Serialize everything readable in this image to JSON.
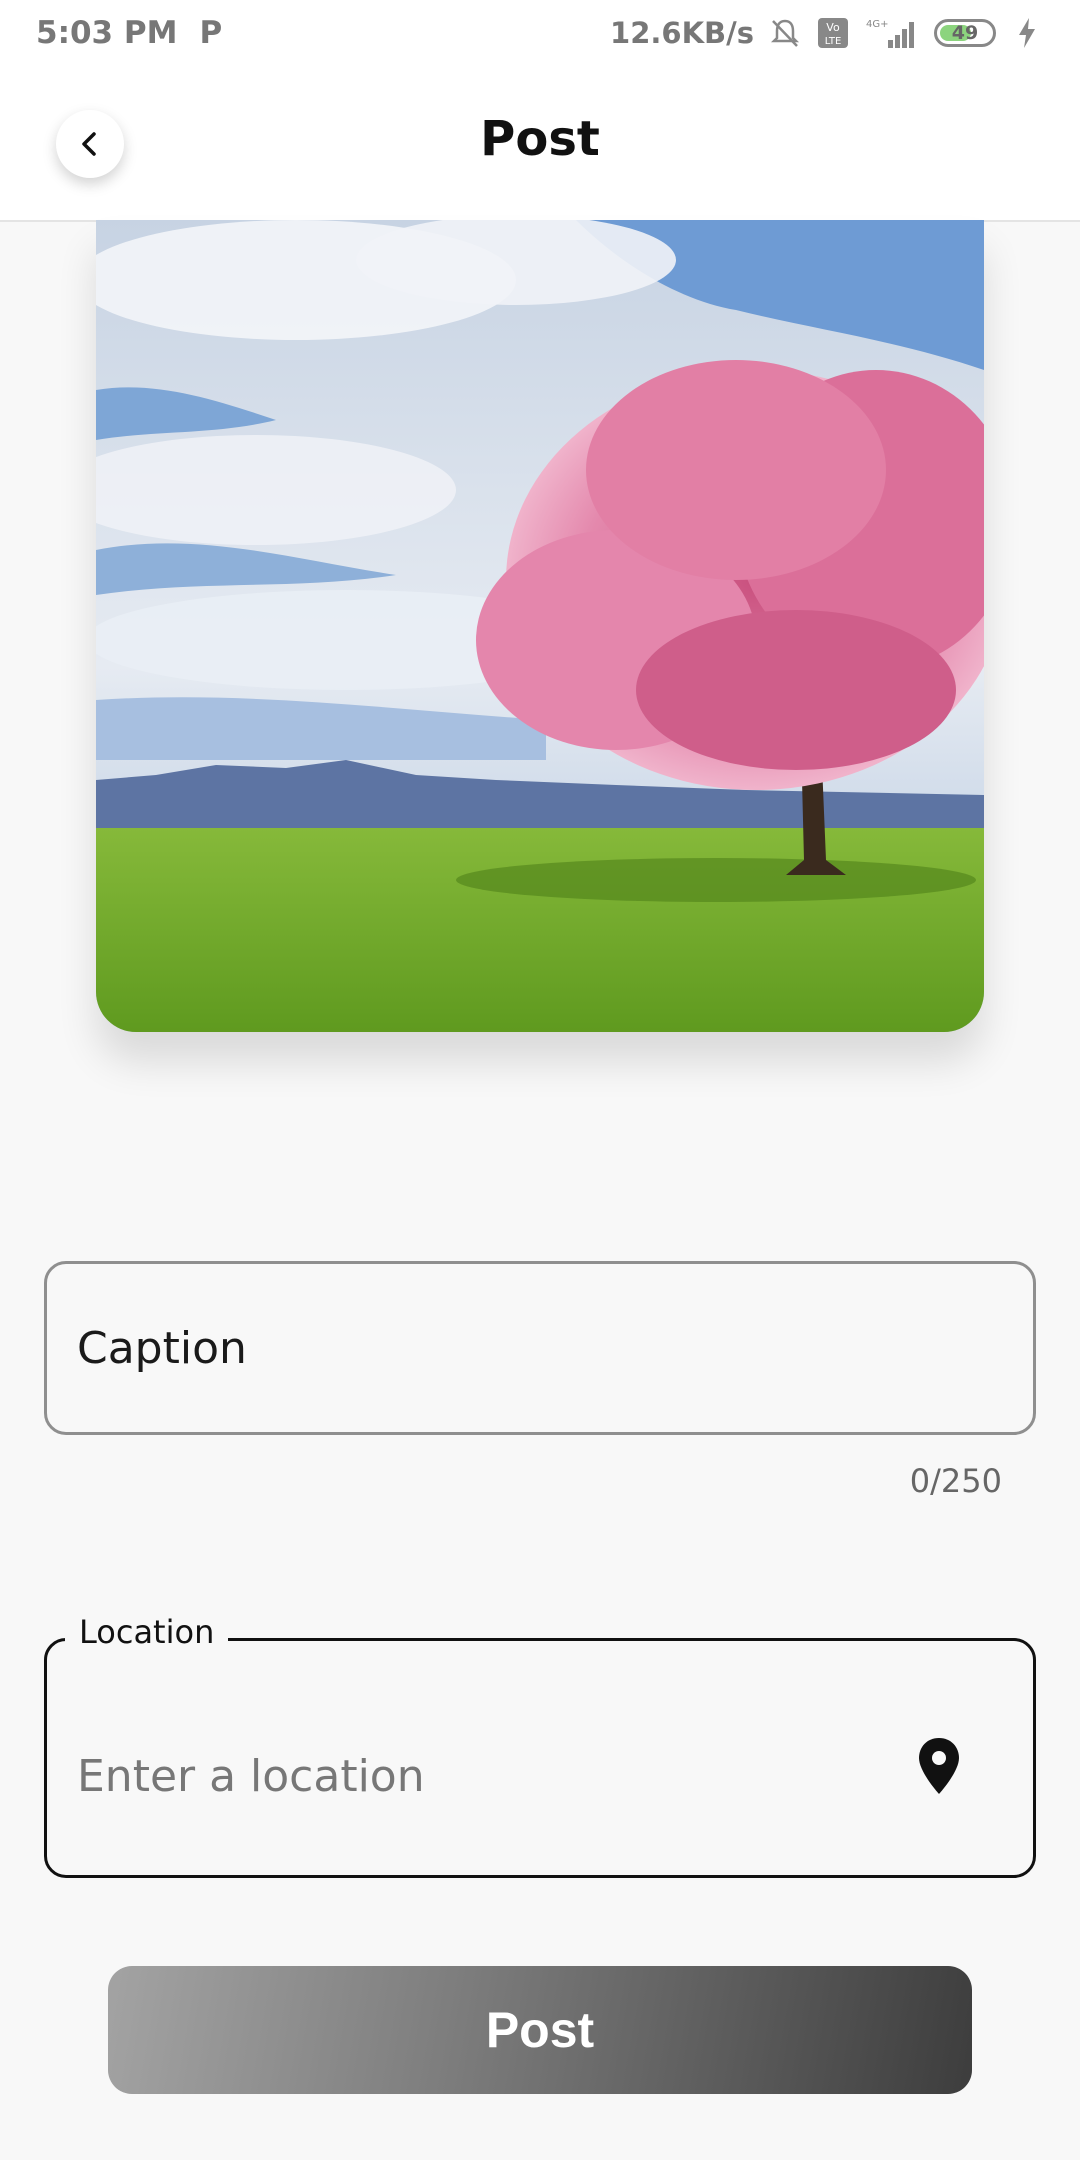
{
  "status_bar": {
    "time": "5:03 PM",
    "carrier_glyph": "P",
    "net_speed": "12.6KB/s",
    "network_type": "4G+",
    "volte": "Vo LTE",
    "battery_level": "49",
    "icons": [
      "mute-icon",
      "volte-icon",
      "signal-icon",
      "battery-icon",
      "charging-icon"
    ]
  },
  "header": {
    "title": "Post",
    "back_icon": "chevron-left-icon"
  },
  "image": {
    "description_icon": "photo-preview"
  },
  "caption": {
    "placeholder": "Caption",
    "counter": "0/250"
  },
  "location": {
    "label": "Location",
    "placeholder": "Enter a location",
    "icon": "location-pin-icon"
  },
  "post_button": {
    "label": "Post"
  },
  "colors": {
    "background": "#f8f8f8",
    "button_gradient_start": "#a3a3a3",
    "button_gradient_end": "#3d3d3d",
    "text_primary": "#111111"
  }
}
